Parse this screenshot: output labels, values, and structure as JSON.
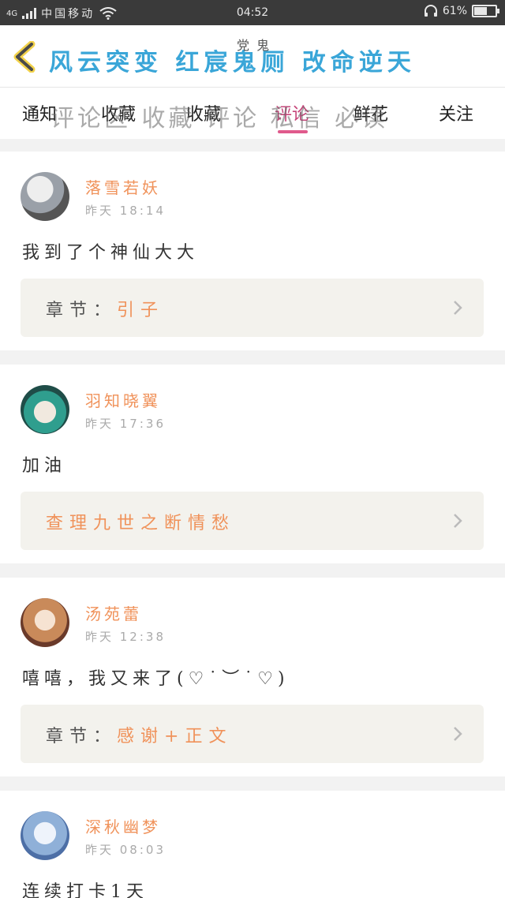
{
  "status_bar": {
    "network": "4G",
    "carrier": "中国移动",
    "time": "04:52",
    "battery": "61%",
    "battery_level": 0.61
  },
  "header": {
    "title": "风云突变 红宸鬼厕 改命逆天",
    "title_sub": "党 鬼"
  },
  "tabs": [
    {
      "label": "通知"
    },
    {
      "label": "收藏"
    },
    {
      "label": "收藏"
    },
    {
      "label": "评论",
      "active": true
    },
    {
      "label": "鲜花"
    },
    {
      "label": "关注"
    }
  ],
  "tabs_overlay": "评论区 收藏 评论 私信 必读",
  "comments": [
    {
      "user": "落雪若妖",
      "time": "昨天 18:14",
      "text": "我到了个神仙大大",
      "chapter_prefix": "章节：",
      "chapter": "引子",
      "avatar_color": "#9aa0a8"
    },
    {
      "user": "羽知晓翼",
      "time": "昨天 17:36",
      "text": "加油",
      "chapter_prefix": "",
      "chapter": "查理九世之断情愁",
      "avatar_color": "#2f9e8e"
    },
    {
      "user": "汤苑蕾",
      "time": "昨天 12:38",
      "text": "嘻嘻，我又来了(♡˙︶˙♡)",
      "chapter_prefix": "章节：",
      "chapter": "感谢+正文",
      "avatar_color": "#c98a5a"
    },
    {
      "user": "深秋幽梦",
      "time": "昨天 08:03",
      "text": "连续打卡1天",
      "chapter_prefix": "",
      "chapter": "",
      "avatar_color": "#8fb0d8"
    }
  ]
}
